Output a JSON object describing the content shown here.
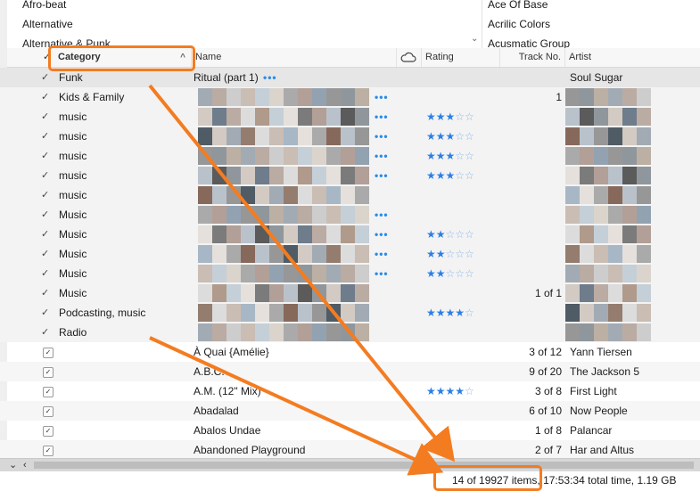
{
  "browser": {
    "genres": [
      "Afro-beat",
      "Alternative",
      "Alternative & Punk"
    ],
    "artists": [
      "Ace Of Base",
      "Acrilic Colors",
      "Acusmatic Group"
    ]
  },
  "header": {
    "check": "✓",
    "category": "Category",
    "name": "Name",
    "cloud_icon": "cloud-icon",
    "rating": "Rating",
    "track_no": "Track No.",
    "artist": "Artist"
  },
  "groups": [
    {
      "category": "Funk",
      "name": "Ritual (part 1)",
      "artist": "Soul Sugar",
      "rating": 0,
      "track": ""
    },
    {
      "category": "Kids & Family",
      "rating": 0,
      "track": "1"
    },
    {
      "category": "music",
      "rating": 3,
      "track": ""
    },
    {
      "category": "music",
      "rating": 3,
      "track": ""
    },
    {
      "category": "music",
      "rating": 3,
      "track": ""
    },
    {
      "category": "music",
      "rating": 3,
      "track": ""
    },
    {
      "category": "music",
      "rating": 0,
      "track": ""
    },
    {
      "category": "Music",
      "rating": 0,
      "track": ""
    },
    {
      "category": "Music",
      "rating": 2,
      "track": ""
    },
    {
      "category": "Music",
      "rating": 2,
      "track": ""
    },
    {
      "category": "Music",
      "rating": 2,
      "track": ""
    },
    {
      "category": "Music",
      "rating": 0,
      "track": "1 of 1"
    },
    {
      "category": "Podcasting, music",
      "rating": 4,
      "track": ""
    },
    {
      "category": "Radio",
      "rating": 0,
      "track": ""
    }
  ],
  "tracks": [
    {
      "name": "À Quai {Amélie}",
      "rating": 0,
      "track": "3 of 12",
      "artist": "Yann Tiersen"
    },
    {
      "name": "A.B.C.",
      "rating": 0,
      "track": "9 of 20",
      "artist": "The Jackson 5"
    },
    {
      "name": "A.M. (12\" Mix)",
      "rating": 4,
      "track": "3 of 8",
      "artist": "First Light"
    },
    {
      "name": "Abadalad",
      "rating": 0,
      "track": "6 of 10",
      "artist": "Now People"
    },
    {
      "name": "Abalos Undae",
      "rating": 0,
      "track": "1 of 8",
      "artist": "Palancar"
    },
    {
      "name": "Abandoned Playground",
      "rating": 0,
      "track": "2 of 7",
      "artist": "Har and Altus"
    }
  ],
  "more_label": "•••",
  "checkmark": "✓",
  "status": "14 of 19927 items, 17:53:34 total time, 1.19 GB",
  "colors": {
    "accent_orange": "#f47c20",
    "star_blue": "#2b7fe6",
    "more_blue": "#2b8be6"
  }
}
